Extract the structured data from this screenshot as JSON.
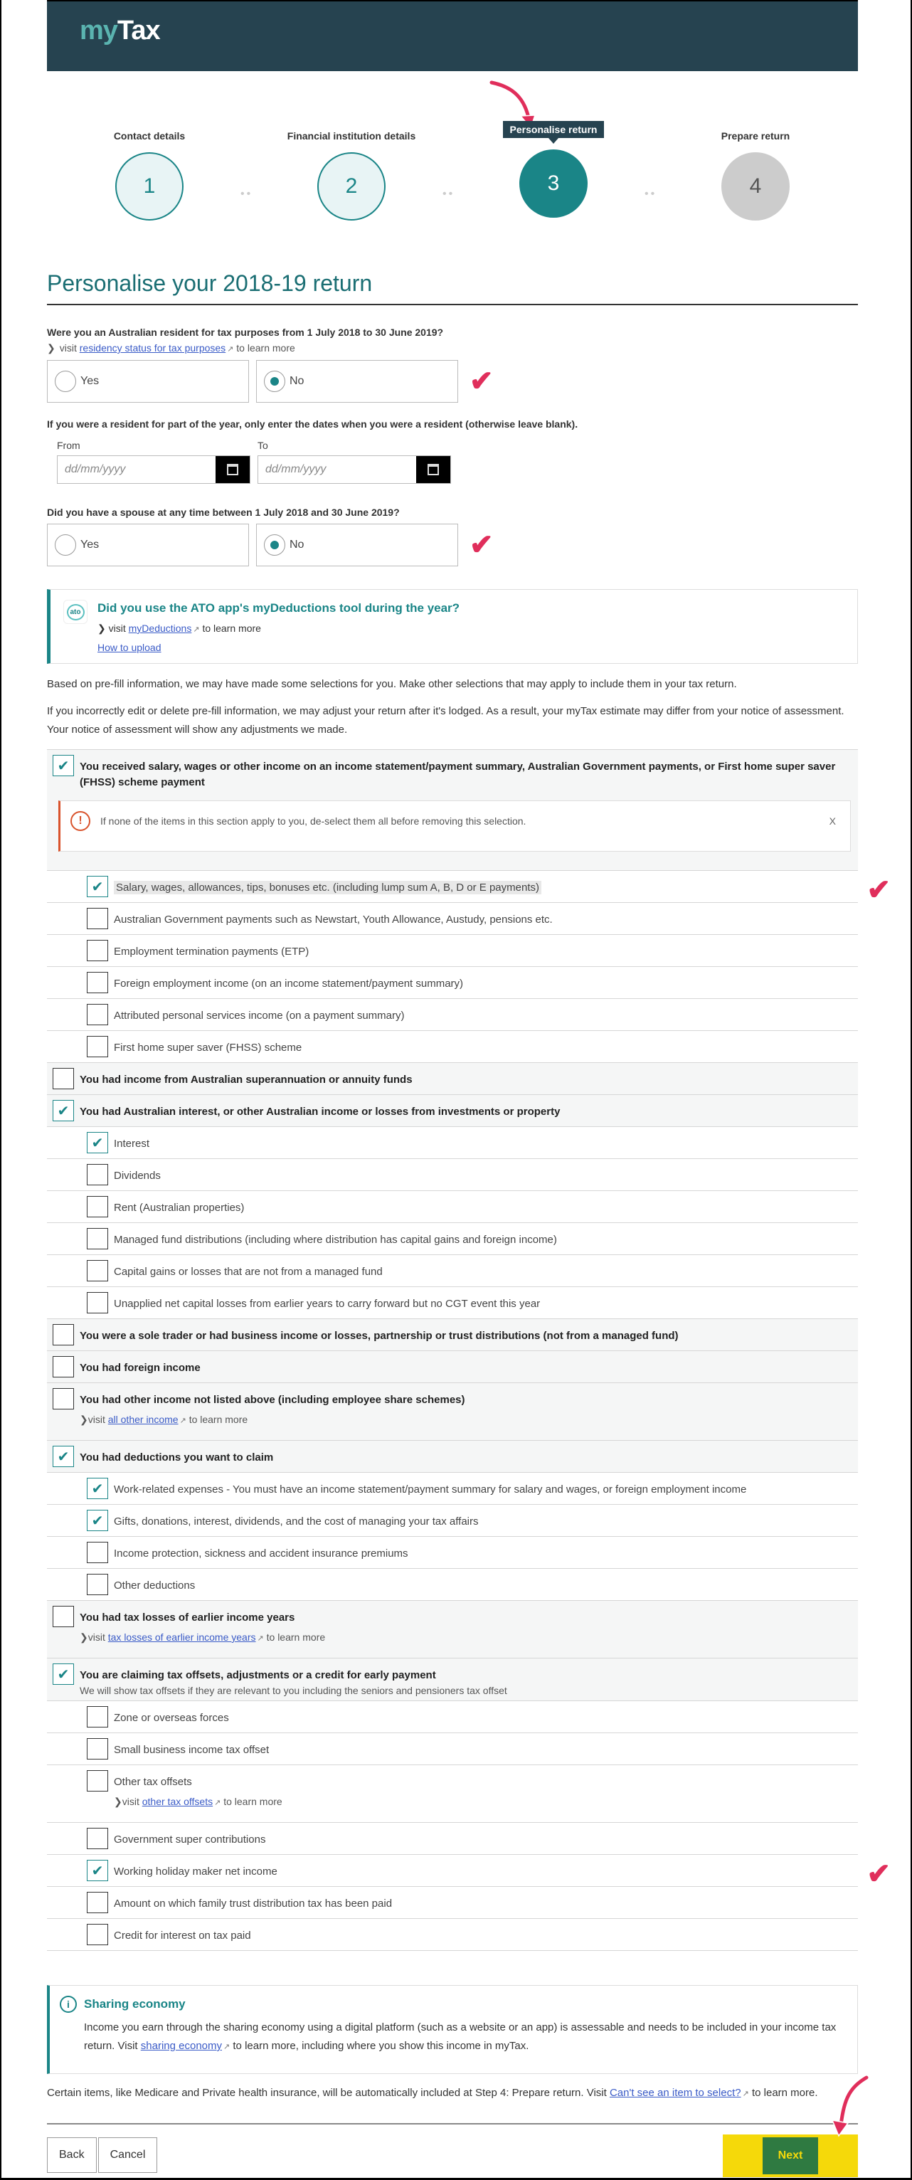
{
  "app": {
    "logo_my": "my",
    "logo_tax": "Tax"
  },
  "stepper": {
    "steps": [
      {
        "number": "1",
        "label": "Contact details",
        "state": "done"
      },
      {
        "number": "2",
        "label": "Financial institution details",
        "state": "done"
      },
      {
        "number": "3",
        "label": "Personalise return",
        "state": "current"
      },
      {
        "number": "4",
        "label": "Prepare return",
        "state": "todo"
      }
    ],
    "dots": "••"
  },
  "page": {
    "title": "Personalise your 2018-19 return"
  },
  "residency": {
    "question": "Were you an Australian resident for tax purposes from 1 July 2018 to 30 June 2019?",
    "learn_prefix": "visit",
    "learn_link": "residency status for tax purposes",
    "learn_suffix": "to learn more",
    "options": [
      "Yes",
      "No"
    ],
    "selected": "No"
  },
  "dates": {
    "question": "If you were a resident for part of the year, only enter the dates when you were a resident (otherwise leave blank).",
    "from_label": "From",
    "to_label": "To",
    "placeholder": "dd/mm/yyyy"
  },
  "spouse": {
    "question": "Did you have a spouse at any time between 1 July 2018 and 30 June 2019?",
    "options": [
      "Yes",
      "No"
    ],
    "selected": "No"
  },
  "ato_box": {
    "icon_text": "ato",
    "title": "Did you use the ATO app's myDeductions tool during the year?",
    "learn_prefix": "visit",
    "learn_link": "myDeductions",
    "learn_suffix": "to learn more",
    "how_to": "How to upload"
  },
  "intro": {
    "para1": "Based on pre-fill information, we may have made some selections for you. Make other selections that may apply to include them in your tax return.",
    "para2": "If you incorrectly edit or delete pre-fill information, we may adjust your return after it's lodged. As a result, your myTax estimate may differ from your notice of assessment. Your notice of assessment will show any adjustments we made."
  },
  "alert": {
    "text": "If none of the items in this section apply to you, de-select them all before removing this selection.",
    "close": "X"
  },
  "checklist": [
    {
      "type": "group",
      "checked": true,
      "label": "You received salary, wages or other income on an income statement/payment summary, Australian Government payments, or First home super saver (FHSS) scheme payment",
      "alert": true
    },
    {
      "type": "sub",
      "checked": true,
      "label": "Salary, wages, allowances, tips, bonuses etc. (including lump sum A, B, D or E payments)",
      "highlight": true,
      "annot": true
    },
    {
      "type": "sub",
      "checked": false,
      "label": "Australian Government payments such as Newstart, Youth Allowance, Austudy, pensions etc."
    },
    {
      "type": "sub",
      "checked": false,
      "label": "Employment termination payments (ETP)"
    },
    {
      "type": "sub",
      "checked": false,
      "label": "Foreign employment income (on an income statement/payment summary)"
    },
    {
      "type": "sub",
      "checked": false,
      "label": "Attributed personal services income (on a payment summary)"
    },
    {
      "type": "sub",
      "checked": false,
      "label": "First home super saver (FHSS) scheme"
    },
    {
      "type": "group",
      "checked": false,
      "label": "You had income from Australian superannuation or annuity funds"
    },
    {
      "type": "group",
      "checked": true,
      "label": "You had Australian interest, or other Australian income or losses from investments or property"
    },
    {
      "type": "sub",
      "checked": true,
      "label": "Interest"
    },
    {
      "type": "sub",
      "checked": false,
      "label": "Dividends"
    },
    {
      "type": "sub",
      "checked": false,
      "label": "Rent (Australian properties)"
    },
    {
      "type": "sub",
      "checked": false,
      "label": "Managed fund distributions (including where distribution has capital gains and foreign income)"
    },
    {
      "type": "sub",
      "checked": false,
      "label": "Capital gains or losses that are not from a managed fund"
    },
    {
      "type": "sub",
      "checked": false,
      "label": "Unapplied net capital losses from earlier years to carry forward but no CGT event this year"
    },
    {
      "type": "group",
      "checked": false,
      "label": "You were a sole trader or had business income or losses, partnership or trust distributions (not from a managed fund)"
    },
    {
      "type": "group",
      "checked": false,
      "label": "You had foreign income"
    },
    {
      "type": "group",
      "checked": false,
      "label": "You had other income not listed above (including employee share schemes)",
      "learn_link": "all other income"
    },
    {
      "type": "group",
      "checked": true,
      "label": "You had deductions you want to claim"
    },
    {
      "type": "sub",
      "checked": true,
      "label": "Work-related expenses - You must have an income statement/payment summary for salary and wages, or foreign employment income"
    },
    {
      "type": "sub",
      "checked": true,
      "label": "Gifts, donations, interest, dividends, and the cost of managing your tax affairs"
    },
    {
      "type": "sub",
      "checked": false,
      "label": "Income protection, sickness and accident insurance premiums"
    },
    {
      "type": "sub",
      "checked": false,
      "label": "Other deductions"
    },
    {
      "type": "group",
      "checked": false,
      "label": "You had tax losses of earlier income years",
      "learn_link": "tax losses of earlier income years"
    },
    {
      "type": "group",
      "checked": true,
      "label": "You are claiming tax offsets, adjustments or a credit for early payment",
      "desc": "We will show tax offsets if they are relevant to you including the seniors and pensioners tax offset"
    },
    {
      "type": "sub",
      "checked": false,
      "label": "Zone or overseas forces"
    },
    {
      "type": "sub",
      "checked": false,
      "label": "Small business income tax offset"
    },
    {
      "type": "sub",
      "checked": false,
      "label": "Other tax offsets",
      "learn_link": "other tax offsets"
    },
    {
      "type": "sub",
      "checked": false,
      "label": "Government super contributions"
    },
    {
      "type": "sub",
      "checked": true,
      "label": "Working holiday maker net income",
      "annot": true
    },
    {
      "type": "sub",
      "checked": false,
      "label": "Amount on which family trust distribution tax has been paid"
    },
    {
      "type": "sub",
      "checked": false,
      "label": "Credit for interest on tax paid"
    }
  ],
  "learn_common": {
    "prefix": "visit",
    "suffix": "to learn more"
  },
  "sharing": {
    "title": "Sharing economy",
    "text_before": "Income you earn through the sharing economy using a digital platform (such as a website or an app) is assessable and needs to be included in your income tax return. Visit ",
    "link": "sharing economy",
    "text_after": " to learn more, including where you show this income in myTax."
  },
  "footer_note": {
    "text_before": "Certain items, like Medicare and Private health insurance, will be automatically included at Step 4: Prepare return. Visit ",
    "link": "Can't see an item to select?",
    "text_after": " to learn more."
  },
  "actions": {
    "back": "Back",
    "cancel": "Cancel",
    "next": "Next"
  },
  "colors": {
    "header": "#264350",
    "accent": "#1a8587",
    "annotation": "#e02e5b",
    "next_button": "#2f7a41",
    "highlight": "#f5d90a"
  }
}
